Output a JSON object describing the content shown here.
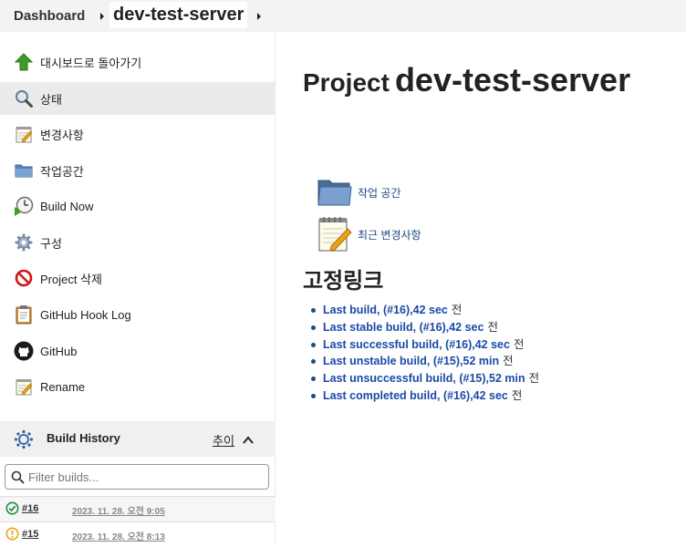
{
  "breadcrumb": {
    "dashboard": "Dashboard",
    "project": "dev-test-server"
  },
  "sidebar": {
    "items": [
      {
        "label": "대시보드로 돌아가기",
        "icon": "up-arrow-icon"
      },
      {
        "label": "상태",
        "icon": "magnifier-icon",
        "active": true
      },
      {
        "label": "변경사항",
        "icon": "notepad-icon"
      },
      {
        "label": "작업공간",
        "icon": "folder-icon"
      },
      {
        "label": "Build Now",
        "icon": "clock-play-icon"
      },
      {
        "label": "구성",
        "icon": "gear-icon"
      },
      {
        "label": "Project 삭제",
        "icon": "no-entry-icon"
      },
      {
        "label": "GitHub Hook Log",
        "icon": "clipboard-icon"
      },
      {
        "label": "GitHub",
        "icon": "github-icon"
      },
      {
        "label": "Rename",
        "icon": "notepad-icon"
      }
    ]
  },
  "build_history": {
    "title": "Build History",
    "trend": "추이",
    "filter_placeholder": "Filter builds...",
    "builds": [
      {
        "number": "#16",
        "time": "2023. 11. 28. 오전 9:05",
        "status": "success"
      },
      {
        "number": "#15",
        "time": "2023. 11. 28. 오전 8:13",
        "status": "unstable"
      }
    ]
  },
  "main": {
    "title_prefix": "Project",
    "title_name": "dev-test-server",
    "actions": [
      {
        "label": "작업 공간",
        "icon": "folder-icon"
      },
      {
        "label": "최근 변경사항",
        "icon": "notepad-icon"
      }
    ],
    "permalinks_title": "고정링크",
    "permalinks": [
      {
        "link": "Last build, (#16),42 sec",
        "suffix": "전"
      },
      {
        "link": "Last stable build, (#16),42 sec",
        "suffix": "전"
      },
      {
        "link": "Last successful build, (#16),42 sec",
        "suffix": "전"
      },
      {
        "link": "Last unstable build, (#15),52 min",
        "suffix": "전"
      },
      {
        "link": "Last unsuccessful build, (#15),52 min",
        "suffix": "전"
      },
      {
        "link": "Last completed build, (#16),42 sec",
        "suffix": "전"
      }
    ]
  },
  "colors": {
    "link": "#1a4aa7",
    "success": "#1e8a3a",
    "unstable": "#e8a317"
  }
}
